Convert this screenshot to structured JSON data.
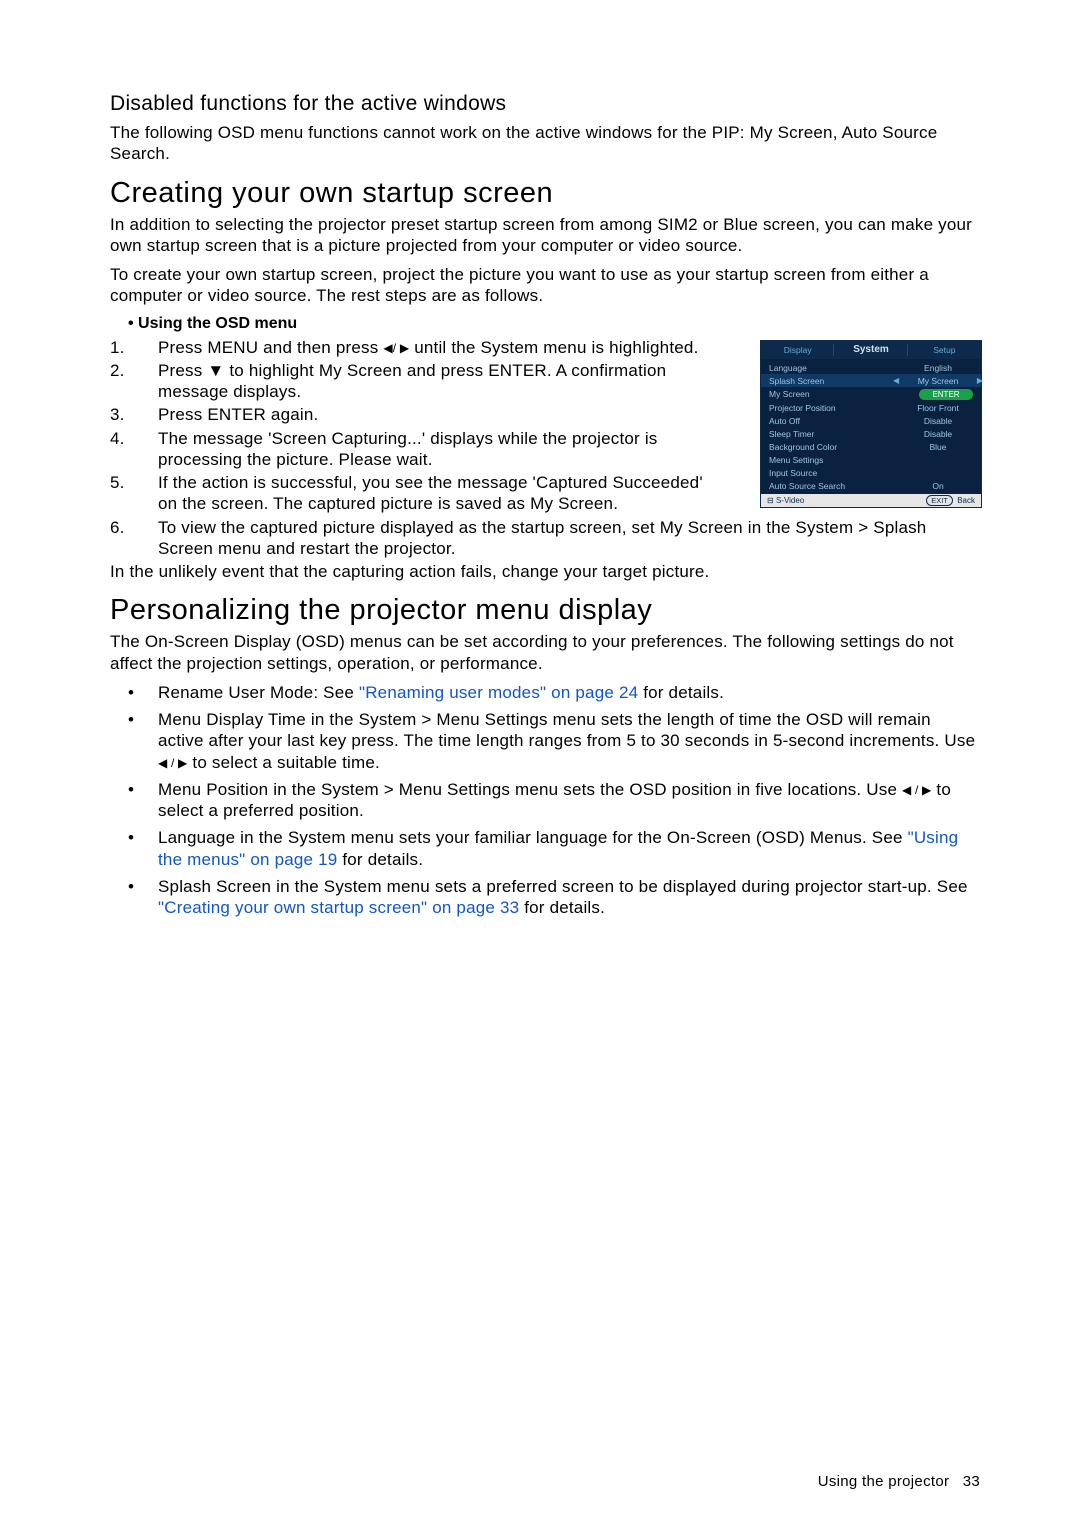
{
  "h3_disabled": "Disabled functions for the active windows",
  "p_disabled": "The following OSD menu functions cannot work on the active windows for the PIP: My Screen, Auto Source Search.",
  "h2_creating": "Creating your own startup screen",
  "p_creating_1": "In addition to selecting the projector preset startup screen from among SIM2 or Blue screen, you can make your own startup screen that is a picture projected from your computer or video source.",
  "p_creating_2": "To create your own startup screen, project the picture you want to use as your startup screen from either a computer or video source. The rest steps are as follows.",
  "bullet_using": "•   Using the OSD menu",
  "steps": {
    "s1a": "Press MENU and then press ",
    "s1b": " until the System menu is highlighted.",
    "s2": "Press ▼ to highlight My Screen and press ENTER. A confirmation message displays.",
    "s3": " Press ENTER again.",
    "s4": "The message 'Screen Capturing...' displays while the projector is processing the picture. Please wait.",
    "s5": "If the action is successful, you see the message 'Captured Succeeded' on the screen. The captured picture is saved as My Screen.",
    "s6": "To view the captured picture displayed as the startup screen, set My Screen in the System > Splash Screen menu and restart the projector."
  },
  "p_unlikely": "In the unlikely event that the capturing action fails, change your target picture.",
  "h2_personal": "Personalizing the projector menu display",
  "p_personal": "The On-Screen Display (OSD) menus can be set according to your preferences. The following settings do not affect the projection settings, operation, or performance.",
  "bullets": {
    "b1a": "Rename User Mode: See ",
    "b1link": "\"Renaming user modes\" on page 24",
    "b1b": " for details.",
    "b2a": "Menu Display Time in the System > Menu Settings menu sets the length of time the OSD will remain active after your last key press. The time length ranges from 5 to 30 seconds in 5-second increments. Use ",
    "b2b": " to select a suitable time.",
    "b3a": "Menu Position in the System > Menu Settings menu sets the OSD position in five locations. Use ",
    "b3b": " to select a preferred position.",
    "b4a": "Language in the System menu sets your familiar language for the On-Screen (OSD) Menus. See ",
    "b4link": "\"Using the menus\" on page 19",
    "b4b": " for details.",
    "b5a": "Splash Screen in the System menu sets a preferred screen to be displayed during projector start-up. See ",
    "b5link": "\"Creating your own startup screen\" on page 33",
    "b5b": " for details."
  },
  "arrows_lr": "◀/ ▶",
  "arrows_lr2": "◀ / ▶",
  "osd": {
    "tabs": {
      "left": "Display",
      "center": "System",
      "right": "Setup"
    },
    "rows": {
      "language": {
        "label": "Language",
        "val": "English"
      },
      "splash": {
        "label": "Splash Screen",
        "val": "My Screen"
      },
      "myscreen": {
        "label": "My Screen",
        "val": "ENTER"
      },
      "projpos": {
        "label": "Projector Position",
        "val": "Floor Front"
      },
      "autooff": {
        "label": "Auto Off",
        "val": "Disable"
      },
      "sleep": {
        "label": "Sleep Timer",
        "val": "Disable"
      },
      "bg": {
        "label": "Background Color",
        "val": "Blue"
      },
      "menuset": {
        "label": "Menu Settings",
        "val": ""
      },
      "inputsrc": {
        "label": "Input Source",
        "val": ""
      },
      "autosrc": {
        "label": "Auto Source Search",
        "val": "On"
      }
    },
    "foot_left": "S-Video",
    "foot_exit": "EXIT",
    "foot_back": "Back"
  },
  "footer": "Using the projector",
  "page_num": "33"
}
